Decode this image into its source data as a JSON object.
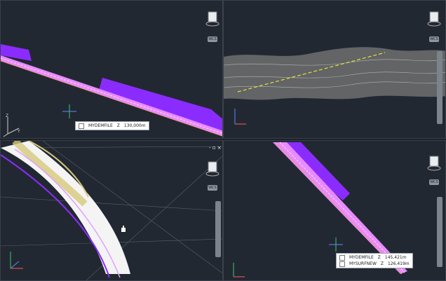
{
  "viewports": {
    "top_left": {
      "tooltip": {
        "name": "MYDEMFILE",
        "axis": "Z",
        "value": "130,000m"
      },
      "wcs": "WCS"
    },
    "top_right": {
      "wcs": "WCS"
    },
    "bottom_left": {
      "wcs": "WCS",
      "controls": "- ▫ ×"
    },
    "bottom_right": {
      "wcs": "WCS",
      "tooltip_rows": [
        {
          "name": "MYDEMFILE",
          "axis": "Z",
          "value": "145,421m"
        },
        {
          "name": "MYSURFNEW",
          "axis": "Z",
          "value": "126,419m"
        }
      ]
    }
  },
  "colors": {
    "background": "#222832",
    "tunnel_purple": "#8b2cff",
    "track_pink": "#f2a0ff",
    "terrain_grey": "#9a9a9a",
    "arch_yellow": "#d6c97a"
  },
  "icons": [
    "viewcube-icon",
    "ucs-axis-icon",
    "cursor-icon",
    "navigation-bar"
  ]
}
